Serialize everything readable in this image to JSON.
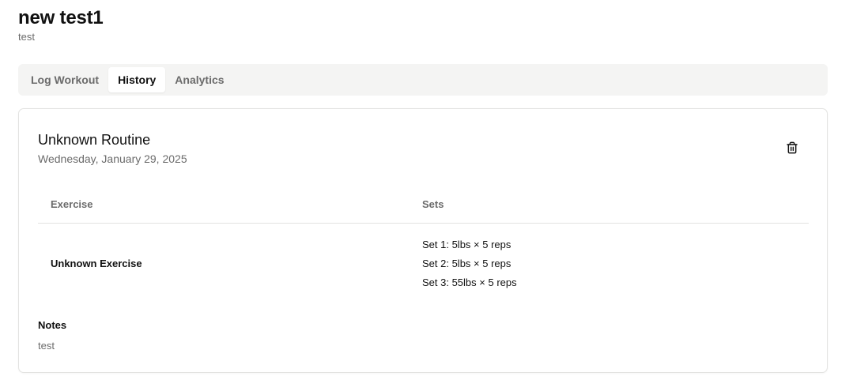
{
  "header": {
    "title": "new test1",
    "subtitle": "test"
  },
  "tabs": [
    {
      "label": "Log Workout",
      "active": false
    },
    {
      "label": "History",
      "active": true
    },
    {
      "label": "Analytics",
      "active": false
    }
  ],
  "workout": {
    "routine_name": "Unknown Routine",
    "date": "Wednesday, January 29, 2025",
    "delete_icon": "trash-icon",
    "table": {
      "columns": [
        "Exercise",
        "Sets"
      ],
      "rows": [
        {
          "exercise": "Unknown Exercise",
          "sets": [
            "Set 1: 5lbs × 5 reps",
            "Set 2: 5lbs × 5 reps",
            "Set 3: 55lbs × 5 reps"
          ]
        }
      ]
    },
    "notes_label": "Notes",
    "notes": "test"
  }
}
